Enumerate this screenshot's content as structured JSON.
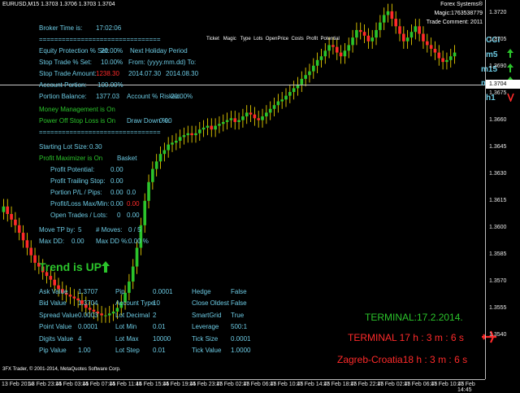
{
  "header": {
    "symbol_line": "EURUSD,M15  1.3703 1.3706 1.3703 1.3704",
    "brand": "Forex Systems®",
    "magic": "Magic:1763538779",
    "trade_comment": "Trade Comment: 2011",
    "columns": [
      "Ticket",
      "Magic",
      "Type",
      "Lots",
      "OpenPrice",
      "Costs",
      "Profit",
      "Potential"
    ]
  },
  "info": {
    "broker_time_label": "Broker Time is:",
    "broker_time_value": "17:02:06",
    "separator": "================================",
    "equity_protection_label": "Equity Protection % Set:",
    "equity_protection_value": "20.00%",
    "stop_trade_label": "Stop Trade % Set:",
    "stop_trade_value": "10.00%",
    "stop_trade_amount_label": "Stop Trade Amount:",
    "stop_trade_amount_value": "1238.30",
    "account_portion_label": "Account Portion:",
    "account_portion_value": "100.00%",
    "portion_balance_label": "Portion Balance:",
    "portion_balance_value": "1377.03",
    "account_risked_label": "Account % Risked:",
    "account_risked_value": "20.00%",
    "money_management": "Money Management is On",
    "power_off_stop_loss": "Power Off Stop Loss is On",
    "draw_down_label": "Draw Down %:",
    "draw_down_value": "0.00",
    "next_holiday_label": "Next Holiday Period",
    "holiday_format": "From: (yyyy.mm.dd) To:",
    "holiday_from": "2014.07.30",
    "holiday_to": "2014.08.30",
    "starting_lot_label": "Starting Lot Size:",
    "starting_lot_value": "0.30",
    "profit_maximizer": "Profit Maximizer is On",
    "basket_label": "Basket",
    "profit_potential_label": "Profit Potential:",
    "profit_potential_value": "0.00",
    "profit_trailing_label": "Profit Trailing Stop:",
    "profit_trailing_value": "0.00",
    "portion_pl_label": "Portion P/L / Pips:",
    "portion_pl_value": "0.00",
    "portion_pl_pips": "0.0",
    "profit_loss_max_label": "Profit/Loss Max/Min:",
    "profit_loss_max": "0.00",
    "profit_loss_min": "0.00",
    "open_trades_label": "Open Trades / Lots:",
    "open_trades_value": "0",
    "open_lots_value": "0.00",
    "move_tp_label": "Move TP by:",
    "move_tp_value": "5",
    "moves_label": "# Moves:",
    "moves_value": "0 / 5",
    "max_dd_label": "Max DD:",
    "max_dd_value": "0.00",
    "max_dd_pct_label": "Max DD %:",
    "max_dd_pct_value": "0.00 %"
  },
  "trend": {
    "text": "Trend is UP",
    "arrow": "up-arrow"
  },
  "signals": [
    {
      "label": "CCI",
      "arrow": ""
    },
    {
      "label": "m5",
      "arrow": "up"
    },
    {
      "label": "m15",
      "arrow": "up"
    },
    {
      "label": "m30",
      "arrow": "up"
    },
    {
      "label": "h1",
      "arrow": "down"
    }
  ],
  "market_info": [
    {
      "label": "Ask Value",
      "value": "1.3707"
    },
    {
      "label": "Bid Value",
      "value": "1.3704"
    },
    {
      "label": "Spread Value",
      "value": "0.0003"
    },
    {
      "label": "Point Value",
      "value": "0.0001"
    },
    {
      "label": "Digits Value",
      "value": "4"
    },
    {
      "label": "Pip Value",
      "value": "1.00"
    }
  ],
  "market_info2": [
    {
      "label": "Pip",
      "value": "0.0001"
    },
    {
      "label": "Account Type",
      "value": "10"
    },
    {
      "label": "Lot Decimal",
      "value": "2"
    },
    {
      "label": "Lot Min",
      "value": "0.01"
    },
    {
      "label": "Lot Max",
      "value": "10000"
    },
    {
      "label": "Lot Step",
      "value": "0.01"
    }
  ],
  "market_info3": [
    {
      "label": "Hedge",
      "value": "False"
    },
    {
      "label": "Close Oldest",
      "value": "False"
    },
    {
      "label": "SmartGrid",
      "value": "True"
    },
    {
      "label": "Leverage",
      "value": "500:1"
    },
    {
      "label": "Tick Size",
      "value": "0.0001"
    },
    {
      "label": "Tick Value",
      "value": "1.0000"
    }
  ],
  "clocks": {
    "terminal_date": "TERMINAL:17.2.2014.",
    "terminal_time": "TERMINAL 17 h : 3 m : 6 s",
    "zagreb_time": "Zagreb-Croatia18 h : 3 m : 6 s"
  },
  "footer": {
    "copyright": "3FX Trader, © 2001-2014, MetaQuotes Software Corp."
  },
  "price_axis": [
    "1.3720",
    "1.3705",
    "1.3690",
    "1.3675",
    "1.3660",
    "1.3645",
    "1.3630",
    "1.3615",
    "1.3600",
    "1.3585",
    "1.3570",
    "1.3555",
    "1.3540"
  ],
  "current_price": "1.3704",
  "time_axis": [
    "13 Feb 2014",
    "13 Feb 23:45",
    "14 Feb 03:45",
    "14 Feb 07:45",
    "14 Feb 11:45",
    "14 Feb 15:45",
    "14 Feb 19:45",
    "14 Feb 23:45",
    "17 Feb 02:45",
    "17 Feb 06:45",
    "17 Feb 10:45",
    "17 Feb 14:45",
    "17 Feb 18:45",
    "17 Feb 22:45",
    "17 Feb 02:45",
    "17 Feb 06:45",
    "17 Feb 10:45",
    "17 Feb 14:45"
  ],
  "colors": {
    "bull": "#2bc42b",
    "bear": "#ff2a2a",
    "info": "#6ccae3",
    "wick": "#ffe400"
  },
  "chart_data": {
    "type": "candlestick",
    "closes": [
      1.3622,
      1.3618,
      1.3615,
      1.3612,
      1.3608,
      1.3604,
      1.36,
      1.3596,
      1.3592,
      1.359,
      1.3587,
      1.3585,
      1.3583,
      1.358,
      1.3578,
      1.3576,
      1.3575,
      1.3574,
      1.3573,
      1.3572,
      1.357,
      1.3568,
      1.3567,
      1.3566,
      1.3565,
      1.3564,
      1.3564,
      1.3565,
      1.3566,
      1.3568,
      1.3571,
      1.3576,
      1.3582,
      1.359,
      1.36,
      1.3612,
      1.3625,
      1.3635,
      1.3642,
      1.3646,
      1.365,
      1.3652,
      1.3655,
      1.3656,
      1.3657,
      1.3659,
      1.366,
      1.3661,
      1.366,
      1.3661,
      1.3663,
      1.3664,
      1.3665,
      1.3663,
      1.3665,
      1.3666,
      1.3667,
      1.3668,
      1.3669,
      1.3667,
      1.3668,
      1.367,
      1.3672,
      1.3671,
      1.3669,
      1.3668,
      1.367,
      1.3672,
      1.3674,
      1.3676,
      1.3678,
      1.3679,
      1.3681,
      1.3683,
      1.3685,
      1.3687,
      1.369,
      1.3692,
      1.3694,
      1.3697,
      1.37,
      1.3702,
      1.3705,
      1.3708,
      1.3707,
      1.3704,
      1.3702,
      1.3705,
      1.3708,
      1.3712,
      1.3716,
      1.3715,
      1.3713,
      1.371,
      1.3712,
      1.3716,
      1.372,
      1.3724,
      1.3726,
      1.3722,
      1.3718,
      1.3714,
      1.371,
      1.3712,
      1.3715,
      1.3718,
      1.3714,
      1.371,
      1.3708,
      1.3706,
      1.3704,
      1.3701,
      1.3699,
      1.37,
      1.3702,
      1.3704
    ],
    "ylim": [
      1.353,
      1.3732
    ]
  }
}
